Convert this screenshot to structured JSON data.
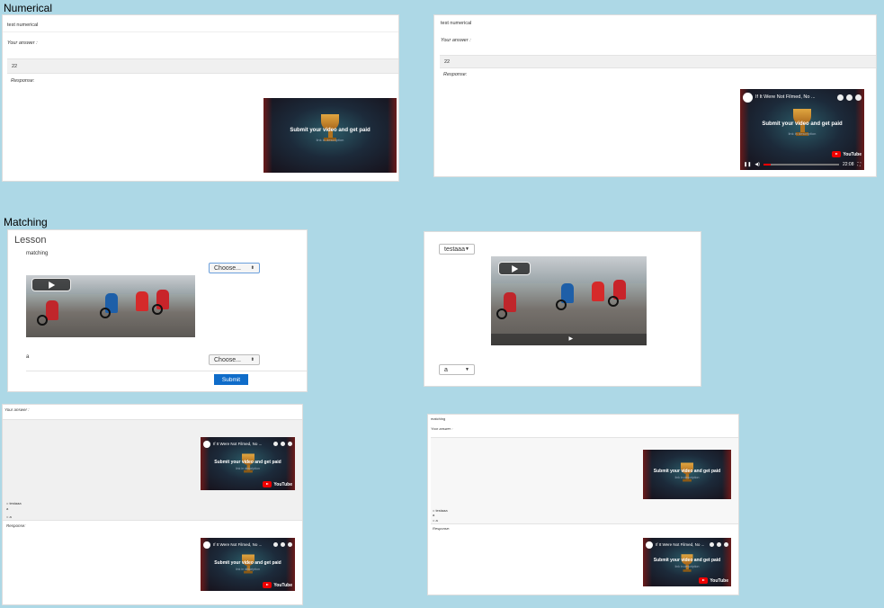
{
  "sections": {
    "numerical": "Numerical",
    "matching": "Matching"
  },
  "num_left": {
    "question": "test numerical",
    "your_answer_label": "Your answer :",
    "answer_value": "22",
    "response_label": "Response:"
  },
  "num_right": {
    "question": "test numerical",
    "your_answer_label": "Your answer :",
    "answer_value": "22",
    "response_label": "Response:"
  },
  "video": {
    "headline": "Submit your video and get paid",
    "sub": "link in description",
    "yt_title": "If It Were Not Filmed, No ...",
    "yt_brand": "YouTube",
    "time": "22:08",
    "progress": 0.1
  },
  "lesson": {
    "title": "Lesson",
    "prompt": "matching",
    "select1": "Choose...",
    "item_a": "a",
    "select2": "Choose...",
    "submit": "Submit"
  },
  "match_right": {
    "select1": "testaaa",
    "select2": "a"
  },
  "review_left": {
    "your_answer_label": "Your answer :",
    "answer_line1": "= testaaa",
    "answer_line2": "a",
    "answer_line3": "= a",
    "response_label": "Response:"
  },
  "review_right": {
    "prompt": "matching",
    "your_answer_label": "Your answer :",
    "answer_line1": "= testaaa",
    "answer_line2": "a",
    "answer_line3": "= a",
    "response_label": "Response:"
  },
  "icons": {
    "select_arrows": "updown-arrows-icon",
    "play": "play-icon",
    "pause": "pause-icon",
    "volume": "volume-icon",
    "fullscreen": "fullscreen-icon"
  },
  "colors": {
    "background": "#add8e6",
    "submit": "#0f6cc9",
    "yt_red": "#ff0000"
  }
}
